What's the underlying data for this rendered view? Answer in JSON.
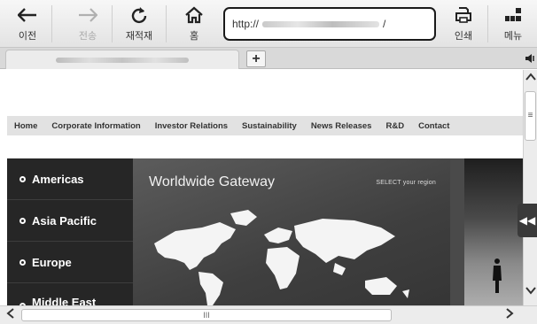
{
  "toolbar": {
    "back_label": "이전",
    "forward_label": "전송",
    "reload_label": "재적재",
    "home_label": "홈",
    "print_label": "인쇄",
    "menu_label": "메뉴",
    "address_prefix": "http://",
    "address_suffix": "/"
  },
  "tabs": {
    "new_tab_label": "+"
  },
  "site": {
    "nav": [
      "Home",
      "Corporate Information",
      "Investor Relations",
      "Sustainability",
      "News Releases",
      "R&D",
      "Contact"
    ],
    "regions": [
      "Americas",
      "Asia Pacific",
      "Europe",
      "Middle East"
    ],
    "hero_title": "Worldwide Gateway",
    "hero_subtitle": "SELECT your region"
  },
  "scrollbars": {
    "vertical_thumb_glyph": "≡",
    "horizontal_thumb_glyph": "III",
    "side_tab_glyph": "◀◀"
  },
  "icons": [
    "back-arrow-icon",
    "forward-arrow-icon",
    "reload-icon",
    "home-icon",
    "print-icon",
    "menu-icon",
    "speaker-icon"
  ]
}
